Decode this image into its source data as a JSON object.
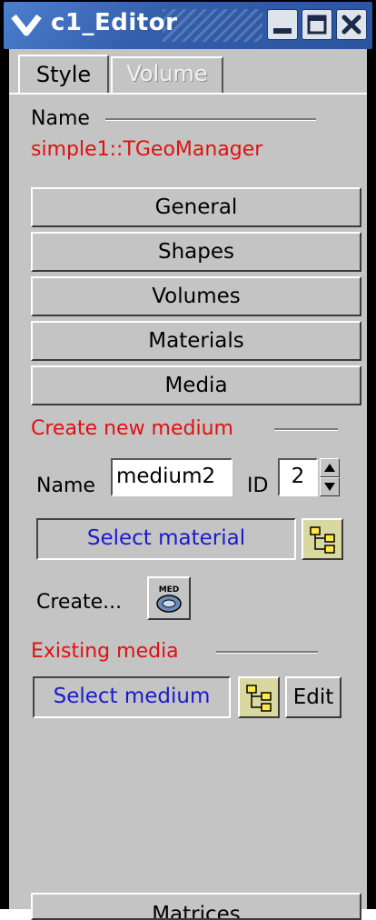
{
  "window": {
    "title": "c1_Editor",
    "menu_icon": "chevron-down-icon",
    "buttons": [
      "minimize-icon",
      "maximize-icon",
      "close-icon"
    ]
  },
  "tabs": [
    {
      "label": "Style",
      "active": true
    },
    {
      "label": "Volume",
      "active": false
    }
  ],
  "name_section": {
    "label": "Name",
    "value": "simple1::TGeoManager"
  },
  "category_buttons": [
    "General",
    "Shapes",
    "Volumes",
    "Materials",
    "Media"
  ],
  "create_medium": {
    "header": "Create new medium",
    "name_label": "Name",
    "name_value": "medium2",
    "id_label": "ID",
    "id_value": "2",
    "select_material": "Select material",
    "create_label": "Create...",
    "create_icon_text": "MED"
  },
  "existing_media": {
    "header": "Existing media",
    "select_medium": "Select medium",
    "edit_label": "Edit"
  },
  "bottom_button": "Matrices",
  "colors": {
    "panel": "#c4c4c4",
    "title_bar": "#345fab",
    "section_red": "#e01010",
    "select_blue": "#1a1acc"
  }
}
